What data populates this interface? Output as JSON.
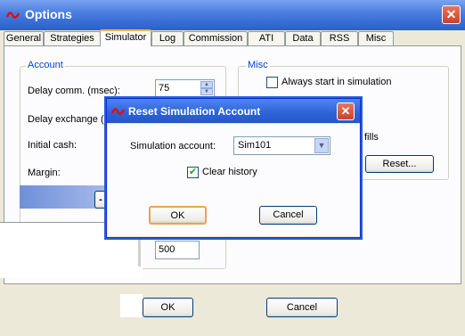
{
  "window": {
    "title": "Options",
    "close_glyph": "✕"
  },
  "tabs": [
    {
      "label": "General"
    },
    {
      "label": "Strategies"
    },
    {
      "label": "Simulator"
    },
    {
      "label": "Log"
    },
    {
      "label": "Commission"
    },
    {
      "label": "ATI"
    },
    {
      "label": "Data"
    },
    {
      "label": "RSS"
    },
    {
      "label": "Misc"
    }
  ],
  "selected_tab": "Simulator",
  "account": {
    "group_label": "Account",
    "delay_comm_label": "Delay comm. (msec):",
    "delay_comm_value": "75",
    "delay_exchange_label": "Delay exchange (m",
    "initial_cash_label": "Initial cash:",
    "margin_label": "Margin:",
    "dash_label": "-",
    "lower_value": "500"
  },
  "misc": {
    "group_label": "Misc",
    "always_start_label": "Always start in simulation",
    "fills_label": "fills",
    "reset_button": "Reset..."
  },
  "footer": {
    "ok": "OK",
    "cancel": "Cancel"
  },
  "dialog": {
    "title": "Reset Simulation Account",
    "close_glyph": "✕",
    "account_label": "Simulation account:",
    "account_value": "Sim101",
    "clear_history_label": "Clear history",
    "clear_history_checked": true,
    "ok": "OK",
    "cancel": "Cancel"
  }
}
